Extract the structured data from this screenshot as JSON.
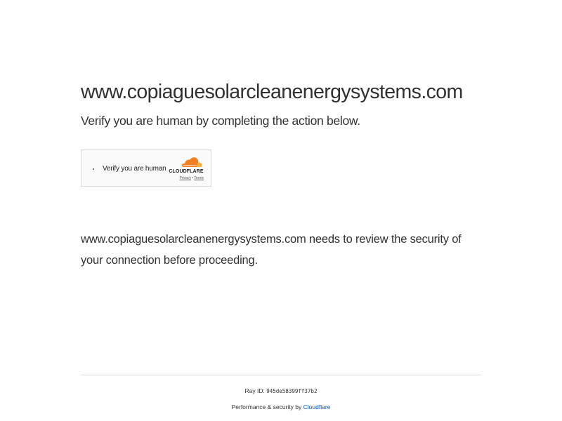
{
  "page": {
    "domain": "www.copiaguesolarcleanenergysystems.com",
    "subtitle": "Verify you are human by completing the action below.",
    "review_text": "www.copiaguesolarcleanenergysystems.com needs to review the security of your connection before proceeding."
  },
  "widget": {
    "label": "Verify you are human",
    "brand": "CLOUDFLARE",
    "privacy_link": "Privacy",
    "link_separator": "•",
    "terms_link": "Terms"
  },
  "footer": {
    "ray_label": "Ray ID:",
    "ray_id": "945de58399ff37b2",
    "performance_text": "Performance & security by",
    "cloudflare_link": "Cloudflare"
  },
  "colors": {
    "text": "#313131",
    "link": "#0051c3",
    "cloudflare_orange": "#f38020",
    "cloudflare_light": "#faae40"
  },
  "icons": [
    "spinner-icon",
    "cloudflare-cloud-icon"
  ]
}
